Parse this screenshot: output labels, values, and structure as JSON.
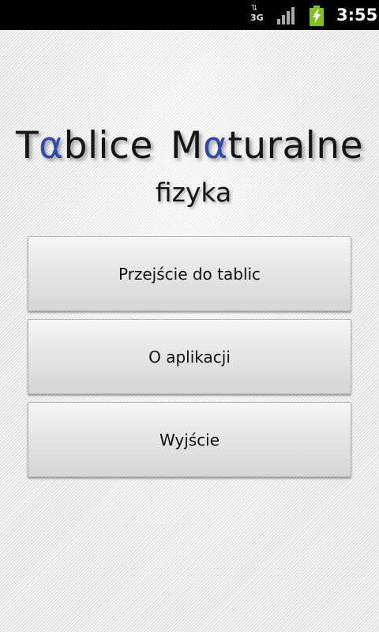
{
  "status_bar": {
    "network_type": "3G",
    "network_activity": "⇅",
    "signal_icon": "signal-bars-icon",
    "battery_icon": "battery-charging-icon",
    "time": "3:55",
    "battery_color": "#7cc21c"
  },
  "header": {
    "title_word1_first": "T",
    "title_word1_alpha": "α",
    "title_word1_rest": "blice",
    "title_word2_first": "M",
    "title_word2_alpha": "α",
    "title_word2_rest": "turalne",
    "subtitle": "fizyka",
    "accent_color": "#2d4aa8"
  },
  "menu": {
    "items": [
      {
        "label": "Przejście do tablic"
      },
      {
        "label": "O aplikacji"
      },
      {
        "label": "Wyjście"
      }
    ]
  }
}
